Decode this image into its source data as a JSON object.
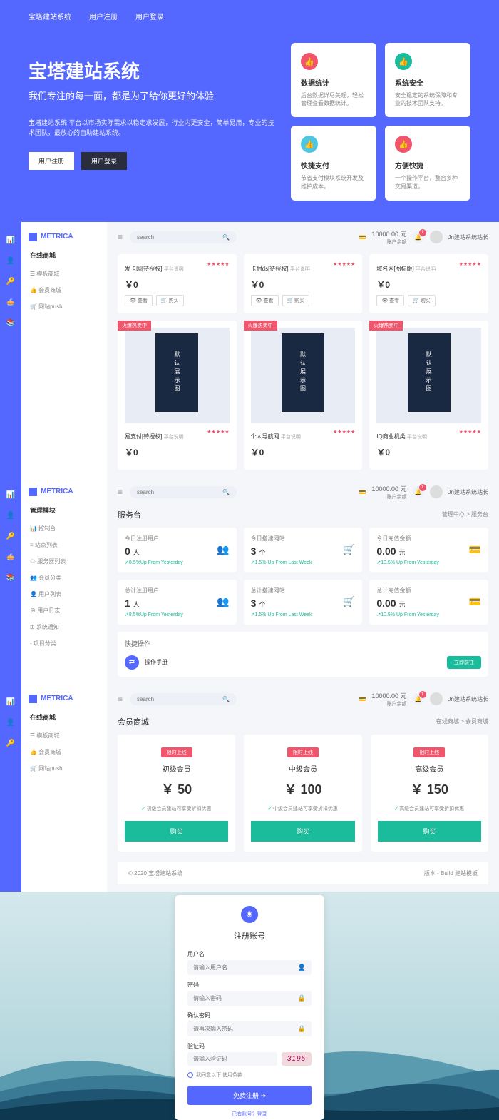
{
  "hero": {
    "nav": [
      "宝塔建站系统",
      "用户注册",
      "用户登录"
    ],
    "title": "宝塔建站系统",
    "subtitle": "我们专注的每一面，都是为了给你更好的体验",
    "desc": "宝塔建站系统 平台以市场实际需求以稳定求发展，行业内更安全，简单易用，专业的技术团队，最放心的自助建站系统。",
    "btn_register": "用户注册",
    "btn_login": "用户登录",
    "cards": [
      {
        "title": "数据统计",
        "text": "后台数据详尽美观，轻松管理查看数据统计。",
        "color": "hc-pink"
      },
      {
        "title": "系统安全",
        "text": "安全稳定的系统保障和专业的技术团队支持。",
        "color": "hc-teal"
      },
      {
        "title": "快捷支付",
        "text": "节省支付模块系统开发及维护成本。",
        "color": "hc-cyan"
      },
      {
        "title": "方便快捷",
        "text": "一个操作平台，整合多种交易渠道。",
        "color": "hc-pink"
      }
    ]
  },
  "s2": {
    "brand": "METRICA",
    "search_ph": "search",
    "balance": "10000.00 元",
    "balance_lbl": "账户余额",
    "user": "Jn建站系统站长",
    "side_head": "在线商城",
    "side_items": [
      "☰ 模板商城",
      "👍 会员商城",
      "🛒 网站push"
    ],
    "row1": [
      {
        "title": "发卡网[待授权]",
        "sub": "平台说明",
        "price": "￥0"
      },
      {
        "title": "卡耐ds[待授权]",
        "sub": "平台说明",
        "price": "￥0"
      },
      {
        "title": "域名网[图标版]",
        "sub": "平台说明",
        "price": "￥0"
      }
    ],
    "btn_view": "查看",
    "btn_buy": "购买",
    "tag": "火爆热卖中",
    "img_text": "默认展示图",
    "row2": [
      {
        "title": "易支付[待授权]",
        "sub": "平台说明",
        "price": "￥0"
      },
      {
        "title": "个人导航网",
        "sub": "平台说明",
        "price": "￥0"
      },
      {
        "title": "IQ商业机类",
        "sub": "平台说明",
        "price": "￥0"
      }
    ]
  },
  "s3": {
    "side_head": "管理模块",
    "side_items": [
      "📊 控制台",
      "≡ 站点列表",
      "☁ 服务器列表",
      "👥 会员分类",
      "👤 用户列表",
      "⊕ 用户日志",
      "⊞ 系统通知",
      "- 项目分类"
    ],
    "page_title": "服务台",
    "crumb": "管理中心 > 服务台",
    "stats": [
      {
        "label": "今日注册用户",
        "val": "0",
        "unit": "人",
        "trend": "↗8.5%Up From Yesterday",
        "icon": "👥",
        "ic": "ic-pink"
      },
      {
        "label": "今日搭建网站",
        "val": "3",
        "unit": "个",
        "trend": "↗1.5% Up From Last Week",
        "icon": "🛒",
        "ic": "ic-blue"
      },
      {
        "label": "今日充值金额",
        "val": "0.00",
        "unit": "元",
        "trend": "↗10.5% Up From Yesterday",
        "icon": "💳",
        "ic": "ic-blue"
      },
      {
        "label": "总计注册用户",
        "val": "1",
        "unit": "人",
        "trend": "↗8.5%Up From Yesterday",
        "icon": "👥",
        "ic": "ic-pink"
      },
      {
        "label": "总计搭建网站",
        "val": "3",
        "unit": "个",
        "trend": "↗1.5% Up From Last Week",
        "icon": "🛒",
        "ic": "ic-blue"
      },
      {
        "label": "总计充值金额",
        "val": "0.00",
        "unit": "元",
        "trend": "↗10.5% Up From Yesterday",
        "icon": "💳",
        "ic": "ic-blue"
      }
    ],
    "quick_title": "快捷操作",
    "quick_text": "操作手册",
    "quick_btn": "立即前往"
  },
  "s4": {
    "side_head": "在线商城",
    "side_items": [
      "☰ 模板商城",
      "👍 会员商城",
      "🛒 网站push"
    ],
    "page_title": "会员商城",
    "crumb": "在线商城 > 会员商城",
    "badge": "限时上线",
    "plans": [
      {
        "name": "初级会员",
        "price": "￥ 50",
        "feat": "初级会员建站可享受折扣优惠"
      },
      {
        "name": "中级会员",
        "price": "￥ 100",
        "feat": "中级会员建站可享受折扣优惠"
      },
      {
        "name": "高级会员",
        "price": "￥ 150",
        "feat": "高级会员建站可享受折扣优惠"
      }
    ],
    "buy": "购买",
    "copyright": "© 2020 宝塔建站系统",
    "footer_right": "版本 - Build 建站模板"
  },
  "reg": {
    "title": "注册账号",
    "fields": [
      {
        "label": "用户名",
        "ph": "请输入用户名",
        "icon": "👤"
      },
      {
        "label": "密码",
        "ph": "请输入密码",
        "icon": "🔒"
      },
      {
        "label": "确认密码",
        "ph": "请再次输入密码",
        "icon": "🔒"
      }
    ],
    "captcha_label": "验证码",
    "captcha_ph": "请输入验证码",
    "captcha_val": "3195",
    "agree": "我同意以下 使用条款",
    "submit": "免费注册 ➔",
    "footer": "已有账号？登录"
  }
}
